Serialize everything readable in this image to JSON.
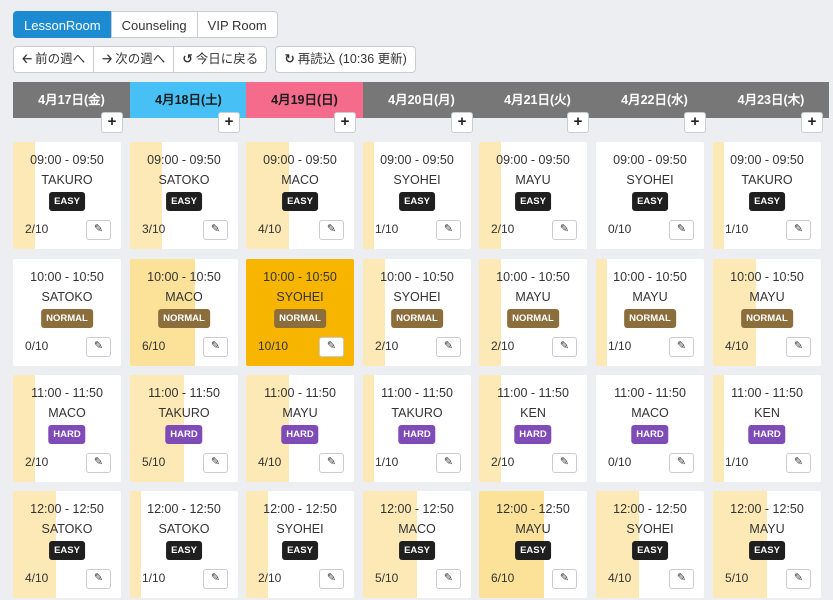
{
  "rooms": [
    {
      "label": "LessonRoom",
      "active": true
    },
    {
      "label": "Counseling",
      "active": false
    },
    {
      "label": "VIP Room",
      "active": false
    }
  ],
  "nav": {
    "prev_week": "前の週へ",
    "next_week": "次の週へ",
    "today": "今日に戻る",
    "reload": "再読込 (10:36 更新)"
  },
  "icons": {
    "prev": "arrow-left-icon",
    "next": "arrow-right-icon",
    "today": "undo-icon",
    "reload": "refresh-icon",
    "add": "plus-icon",
    "edit": "edit-icon"
  },
  "colors": {
    "accent": "#1d8bd1",
    "saturday": "#46c0f5",
    "sunday": "#f56b8c",
    "header": "#777777",
    "easy": "#1f1f1f",
    "normal": "#8b6e3c",
    "hard": "#7f4bb6"
  },
  "days": [
    {
      "label": "4月17日(金)",
      "type": "weekday"
    },
    {
      "label": "4月18日(土)",
      "type": "sat"
    },
    {
      "label": "4月19日(日)",
      "type": "sun"
    },
    {
      "label": "4月20日(月)",
      "type": "weekday"
    },
    {
      "label": "4月21日(火)",
      "type": "weekday"
    },
    {
      "label": "4月22日(水)",
      "type": "weekday"
    },
    {
      "label": "4月23日(木)",
      "type": "weekday"
    }
  ],
  "add_label": "+",
  "edit_label": "✎",
  "slots": [
    [
      {
        "time": "09:00 - 09:50",
        "teacher": "TAKURO",
        "level": "EASY",
        "booked": 2,
        "capacity": 10,
        "count": "2/10"
      },
      {
        "time": "10:00 - 10:50",
        "teacher": "SATOKO",
        "level": "NORMAL",
        "booked": 0,
        "capacity": 10,
        "count": "0/10"
      },
      {
        "time": "11:00 - 11:50",
        "teacher": "MACO",
        "level": "HARD",
        "booked": 2,
        "capacity": 10,
        "count": "2/10"
      },
      {
        "time": "12:00 - 12:50",
        "teacher": "SATOKO",
        "level": "EASY",
        "booked": 4,
        "capacity": 10,
        "count": "4/10"
      }
    ],
    [
      {
        "time": "09:00 - 09:50",
        "teacher": "SATOKO",
        "level": "EASY",
        "booked": 3,
        "capacity": 10,
        "count": "3/10"
      },
      {
        "time": "10:00 - 10:50",
        "teacher": "MACO",
        "level": "NORMAL",
        "booked": 6,
        "capacity": 10,
        "count": "6/10"
      },
      {
        "time": "11:00 - 11:50",
        "teacher": "TAKURO",
        "level": "HARD",
        "booked": 5,
        "capacity": 10,
        "count": "5/10"
      },
      {
        "time": "12:00 - 12:50",
        "teacher": "SATOKO",
        "level": "EASY",
        "booked": 1,
        "capacity": 10,
        "count": "1/10"
      }
    ],
    [
      {
        "time": "09:00 - 09:50",
        "teacher": "MACO",
        "level": "EASY",
        "booked": 4,
        "capacity": 10,
        "count": "4/10"
      },
      {
        "time": "10:00 - 10:50",
        "teacher": "SYOHEI",
        "level": "NORMAL",
        "booked": 10,
        "capacity": 10,
        "count": "10/10"
      },
      {
        "time": "11:00 - 11:50",
        "teacher": "MAYU",
        "level": "HARD",
        "booked": 4,
        "capacity": 10,
        "count": "4/10"
      },
      {
        "time": "12:00 - 12:50",
        "teacher": "SYOHEI",
        "level": "EASY",
        "booked": 2,
        "capacity": 10,
        "count": "2/10"
      }
    ],
    [
      {
        "time": "09:00 - 09:50",
        "teacher": "SYOHEI",
        "level": "EASY",
        "booked": 1,
        "capacity": 10,
        "count": "1/10"
      },
      {
        "time": "10:00 - 10:50",
        "teacher": "SYOHEI",
        "level": "NORMAL",
        "booked": 2,
        "capacity": 10,
        "count": "2/10"
      },
      {
        "time": "11:00 - 11:50",
        "teacher": "TAKURO",
        "level": "HARD",
        "booked": 1,
        "capacity": 10,
        "count": "1/10"
      },
      {
        "time": "12:00 - 12:50",
        "teacher": "MACO",
        "level": "EASY",
        "booked": 5,
        "capacity": 10,
        "count": "5/10"
      }
    ],
    [
      {
        "time": "09:00 - 09:50",
        "teacher": "MAYU",
        "level": "EASY",
        "booked": 2,
        "capacity": 10,
        "count": "2/10"
      },
      {
        "time": "10:00 - 10:50",
        "teacher": "MAYU",
        "level": "NORMAL",
        "booked": 2,
        "capacity": 10,
        "count": "2/10"
      },
      {
        "time": "11:00 - 11:50",
        "teacher": "KEN",
        "level": "HARD",
        "booked": 2,
        "capacity": 10,
        "count": "2/10"
      },
      {
        "time": "12:00 - 12:50",
        "teacher": "MAYU",
        "level": "EASY",
        "booked": 6,
        "capacity": 10,
        "count": "6/10"
      }
    ],
    [
      {
        "time": "09:00 - 09:50",
        "teacher": "SYOHEI",
        "level": "EASY",
        "booked": 0,
        "capacity": 10,
        "count": "0/10"
      },
      {
        "time": "10:00 - 10:50",
        "teacher": "MAYU",
        "level": "NORMAL",
        "booked": 1,
        "capacity": 10,
        "count": "1/10"
      },
      {
        "time": "11:00 - 11:50",
        "teacher": "MACO",
        "level": "HARD",
        "booked": 0,
        "capacity": 10,
        "count": "0/10"
      },
      {
        "time": "12:00 - 12:50",
        "teacher": "SYOHEI",
        "level": "EASY",
        "booked": 4,
        "capacity": 10,
        "count": "4/10"
      }
    ],
    [
      {
        "time": "09:00 - 09:50",
        "teacher": "TAKURO",
        "level": "EASY",
        "booked": 1,
        "capacity": 10,
        "count": "1/10"
      },
      {
        "time": "10:00 - 10:50",
        "teacher": "MAYU",
        "level": "NORMAL",
        "booked": 4,
        "capacity": 10,
        "count": "4/10"
      },
      {
        "time": "11:00 - 11:50",
        "teacher": "KEN",
        "level": "HARD",
        "booked": 1,
        "capacity": 10,
        "count": "1/10"
      },
      {
        "time": "12:00 - 12:50",
        "teacher": "MAYU",
        "level": "EASY",
        "booked": 5,
        "capacity": 10,
        "count": "5/10"
      }
    ]
  ]
}
